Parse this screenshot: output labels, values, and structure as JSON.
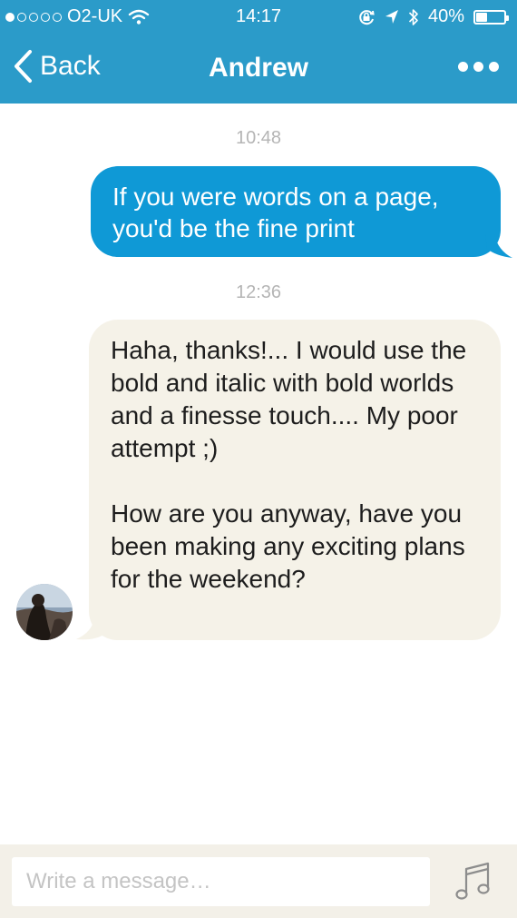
{
  "status_bar": {
    "carrier": "O2-UK",
    "signal_bars_filled": 1,
    "signal_bars_total": 5,
    "time": "14:17",
    "battery_percent": "40%",
    "battery_level": 0.4
  },
  "nav": {
    "back_label": "Back",
    "title": "Andrew"
  },
  "messages": [
    {
      "timestamp": "10:48",
      "direction": "outgoing",
      "paragraphs": [
        "If you were words on a page, you'd be the fine print"
      ]
    },
    {
      "timestamp": "12:36",
      "direction": "incoming",
      "paragraphs": [
        "Haha, thanks!... I would use the bold and italic with bold worlds and a finesse touch.... My poor attempt ;)",
        "How are you anyway, have you been making any exciting plans for the weekend?"
      ]
    }
  ],
  "composer": {
    "placeholder": "Write a message…"
  },
  "colors": {
    "header": "#2b9bc9",
    "outgoing_bubble": "#0f99d6",
    "incoming_bubble": "#f5f2e8"
  },
  "icons": [
    "wifi-icon",
    "rotation-lock-icon",
    "location-arrow-icon",
    "bluetooth-icon",
    "battery-icon",
    "back-chevron-icon",
    "more-dots-icon",
    "music-note-icon"
  ]
}
